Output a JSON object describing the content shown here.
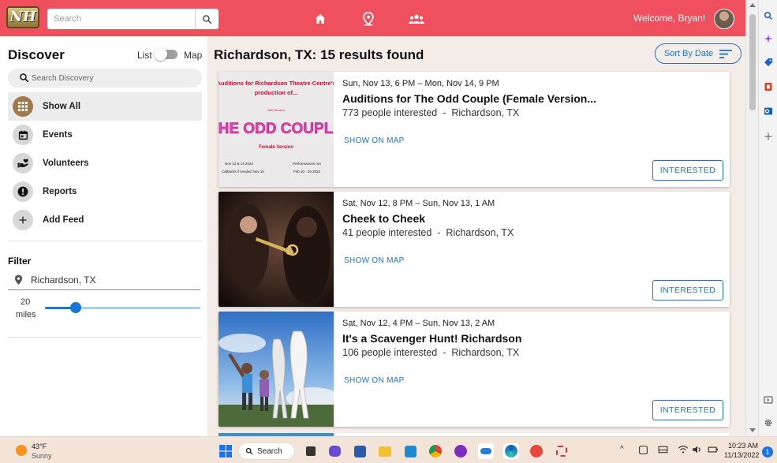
{
  "header": {
    "logo_text": "NH",
    "search_placeholder": "Search",
    "welcome": "Welcome, Bryan!"
  },
  "sidebar": {
    "title": "Discover",
    "view_toggle": {
      "list_label": "List",
      "map_label": "Map"
    },
    "search_placeholder": "Search Discovery",
    "menu": [
      {
        "label": "Show All",
        "icon": "grid-icon",
        "active": true
      },
      {
        "label": "Events",
        "icon": "calendar-icon"
      },
      {
        "label": "Volunteers",
        "icon": "volunteer-hand-icon"
      },
      {
        "label": "Reports",
        "icon": "alert-icon"
      },
      {
        "label": "Add Feed",
        "icon": "plus-icon"
      }
    ],
    "filter": {
      "title": "Filter",
      "location": "Richardson, TX",
      "radius_value": "20",
      "radius_unit": "miles",
      "radius_fraction": 0.2
    }
  },
  "main": {
    "results_title": "Richardson, TX: 15 results found",
    "sort_label": "Sort By Date",
    "cards": [
      {
        "date": "Sun, Nov 13, 6 PM – Mon, Nov 14, 9 PM",
        "title": "Auditions for The Odd Couple (Female Version...",
        "interested_count": "773 people interested",
        "location": "Richardson, TX",
        "show_map": "SHOW ON MAP",
        "interested_btn": "INTERESTED",
        "poster": {
          "line1": "Auditions for Richardson Theatre Centre's",
          "line2": "production of...",
          "author": "Neil Simon's",
          "big_title": "THE ODD COUPLE",
          "subtitle": "Female Version",
          "left_small_1": "Nov 13 & 14 2022",
          "left_small_2": "Callbacks if needed: Nov 15",
          "right_small_1": "Performances run",
          "right_small_2": "Feb 10 - 26 2023"
        }
      },
      {
        "date": "Sat, Nov 12, 8 PM – Sun, Nov 13, 1 AM",
        "title": "Cheek to Cheek",
        "interested_count": "41 people interested",
        "location": "Richardson, TX",
        "show_map": "SHOW ON MAP",
        "interested_btn": "INTERESTED"
      },
      {
        "date": "Sat, Nov 12, 4 PM – Sun, Nov 13, 2 AM",
        "title": "It's a Scavenger Hunt! Richardson",
        "interested_count": "106 people interested",
        "location": "Richardson, TX",
        "show_map": "SHOW ON MAP",
        "interested_btn": "INTERESTED"
      }
    ],
    "separator": "-"
  },
  "taskbar": {
    "weather_temp": "43°F",
    "weather_cond": "Sunny",
    "search_label": "Search",
    "time": "10:23 AM",
    "date": "11/13/2022",
    "notification_count": "1"
  },
  "colors": {
    "brand": "#f0505e",
    "accent": "#1976d2",
    "content_bg": "#f4ece7"
  }
}
